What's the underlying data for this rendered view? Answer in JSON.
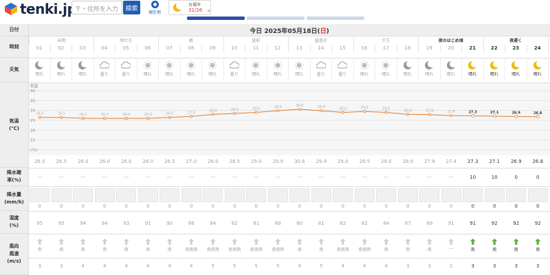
{
  "header": {
    "logo_text": "tenki.jp",
    "search_placeholder": "〒・住所を入力",
    "search_button": "検索",
    "location_button": "現在地",
    "chip_city": "台場市",
    "chip_temp": "31/26",
    "chip_close": "×",
    "tab_colors": [
      "#2f4fa8",
      "#cfd8ea",
      "#cfd8ea"
    ]
  },
  "table": {
    "date_label": "日付",
    "date_prefix": "今日 2025年05月18日(",
    "date_dow": "日",
    "date_suffix": ")",
    "time_label": "時刻",
    "weather_label": "天気",
    "temp_label": "気温",
    "temp_unit": "(℃)",
    "precip_prob_label_1": "降水確",
    "precip_prob_label_2": "率(%)",
    "precip_amt_label_1": "降水量",
    "precip_amt_label_2": "(mm/h)",
    "humidity_label_1": "湿度",
    "humidity_label_2": "(%)",
    "wind_dir_label": "風向",
    "wind_speed_label_1": "風速",
    "wind_speed_label_2": "(m/s)",
    "periods": [
      "未明",
      "明け方",
      "朝",
      "昼前",
      "昼過ぎ",
      "夕方",
      "夜のはじめ頃",
      "夜遅く"
    ],
    "hours": [
      "01",
      "02",
      "03",
      "04",
      "05",
      "06",
      "07",
      "08",
      "09",
      "10",
      "11",
      "12",
      "13",
      "14",
      "15",
      "16",
      "17",
      "18",
      "19",
      "20",
      "21",
      "22",
      "23",
      "24"
    ],
    "weather": [
      "晴れ",
      "晴れ",
      "晴れ",
      "曇り",
      "曇り",
      "晴れ",
      "晴れ",
      "晴れ",
      "晴れ",
      "曇り",
      "晴れ",
      "晴れ",
      "晴れ",
      "曇り",
      "曇り",
      "晴れ",
      "晴れ",
      "晴れ",
      "晴れ",
      "晴れ",
      "晴れ",
      "晴れ",
      "晴れ",
      "晴れ"
    ],
    "weather_icons": [
      "moon-icon",
      "moon-icon",
      "moon-icon",
      "cloud-icon",
      "cloud-icon",
      "sun-icon",
      "sun-icon",
      "sun-icon",
      "sun-icon",
      "cloud-icon",
      "sun-icon",
      "sun-icon",
      "sun-icon",
      "cloud-icon",
      "cloud-icon",
      "sun-icon",
      "sun-icon",
      "moon-icon",
      "moon-icon",
      "moon-icon",
      "moon-icon",
      "moon-icon",
      "moon-icon",
      "moon-icon"
    ],
    "temps": [
      "26.5",
      "26.5",
      "26.0",
      "26.0",
      "26.0",
      "26.0",
      "26.5",
      "27.0",
      "28.0",
      "28.5",
      "29.0",
      "29.9",
      "30.6",
      "29.9",
      "29.0",
      "29.5",
      "29.0",
      "28.0",
      "27.9",
      "27.4",
      "27.3",
      "27.1",
      "26.9",
      "26.8"
    ],
    "precip_prob": [
      "---",
      "---",
      "---",
      "---",
      "---",
      "---",
      "---",
      "---",
      "---",
      "---",
      "---",
      "---",
      "---",
      "---",
      "---",
      "---",
      "---",
      "---",
      "---",
      "---",
      "10",
      "10",
      "0",
      "0"
    ],
    "precip_amt": [
      "0",
      "0",
      "0",
      "0",
      "0",
      "0",
      "0",
      "0",
      "0",
      "0",
      "0",
      "0",
      "0",
      "0",
      "0",
      "0",
      "0",
      "0",
      "0",
      "0",
      "0",
      "0",
      "0",
      "0"
    ],
    "humidity": [
      "95",
      "95",
      "94",
      "94",
      "93",
      "91",
      "90",
      "86",
      "84",
      "82",
      "81",
      "80",
      "80",
      "81",
      "82",
      "82",
      "84",
      "87",
      "89",
      "91",
      "91",
      "92",
      "92",
      "92"
    ],
    "wind_dir": [
      "南",
      "南",
      "南",
      "南",
      "南",
      "南",
      "南",
      "南南西",
      "南南西",
      "南南西",
      "南南西",
      "南南西",
      "南",
      "南",
      "南南西",
      "南南西",
      "南",
      "南",
      "南",
      "---",
      "南",
      "南",
      "南",
      "南"
    ],
    "wind_speed": [
      "3",
      "3",
      "4",
      "4",
      "4",
      "4",
      "4",
      "4",
      "5",
      "5",
      "5",
      "5",
      "4",
      "5",
      "4",
      "4",
      "4",
      "3",
      "3",
      "2",
      "3",
      "3",
      "3",
      "3"
    ]
  },
  "chart_data": {
    "type": "line",
    "x": [
      "01",
      "02",
      "03",
      "04",
      "05",
      "06",
      "07",
      "08",
      "09",
      "10",
      "11",
      "12",
      "13",
      "14",
      "15",
      "16",
      "17",
      "18",
      "19",
      "20",
      "21",
      "22",
      "23",
      "24"
    ],
    "values": [
      26.5,
      26.5,
      26.0,
      26.0,
      26.0,
      26.0,
      26.5,
      27.0,
      28.0,
      28.5,
      29.0,
      29.9,
      30.6,
      29.9,
      29.0,
      29.5,
      29.0,
      28.0,
      27.9,
      27.4,
      27.3,
      27.1,
      26.9,
      26.8
    ],
    "ylabel": "気温",
    "yticks": [
      "40",
      "35",
      "30",
      "25",
      "20",
      "15",
      "(℃)"
    ],
    "ylim": [
      10,
      40
    ],
    "line_color": "#e07b2c",
    "point_color": "#e07b2c"
  }
}
